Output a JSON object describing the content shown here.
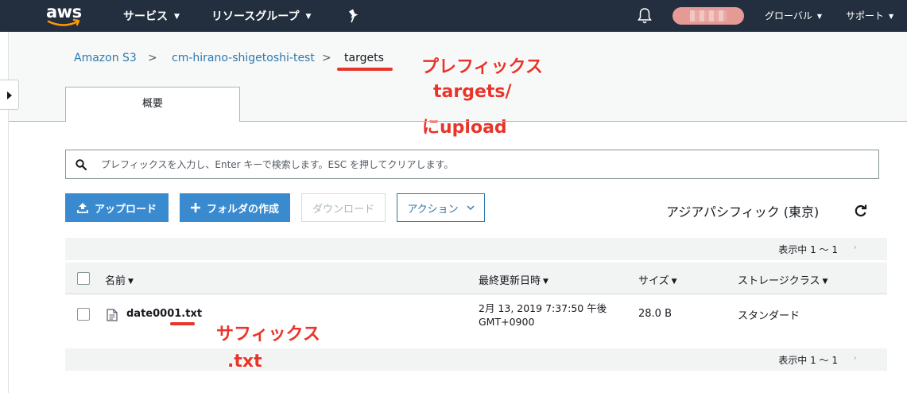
{
  "topnav": {
    "logo": "aws",
    "services": "サービス",
    "resource_groups": "リソースグループ",
    "pin_icon": "pin-icon",
    "bell_icon": "bell-icon",
    "region_menu": "グローバル",
    "support_menu": "サポート"
  },
  "breadcrumb": {
    "root": "Amazon S3",
    "bucket": "cm-hirano-shigetoshi-test",
    "current": "targets",
    "separator": ">"
  },
  "tabs": [
    {
      "label": "概要"
    }
  ],
  "search": {
    "placeholder": "プレフィックスを入力し、Enter キーで検索します。ESC を押してクリアします。"
  },
  "actions": {
    "upload": "アップロード",
    "create_folder": "フォルダの作成",
    "download": "ダウンロード",
    "actions": "アクション",
    "region": "アジアパシフィック (東京)"
  },
  "pager": {
    "text": "表示中 1 〜 1"
  },
  "table": {
    "columns": [
      "名前",
      "最終更新日時",
      "サイズ",
      "ストレージクラス"
    ],
    "rows": [
      {
        "name_base": "date0001",
        "name_ext": ".txt",
        "modified_line1": "2月 13, 2019 7:37:50 午後",
        "modified_line2": "GMT+0900",
        "size": "28.0 B",
        "storage_class": "スタンダード"
      }
    ]
  },
  "annotations": {
    "prefix_line1": "プレフィックス",
    "prefix_line2": "targets/",
    "prefix_line3": "にupload",
    "suffix_line1": "サフィックス",
    "suffix_line2": ".txt"
  },
  "colors": {
    "nav_bg": "#232f3e",
    "primary_blue": "#3a8ad0",
    "link_blue": "#2a7ab0",
    "annotation_red": "#e8352a"
  }
}
